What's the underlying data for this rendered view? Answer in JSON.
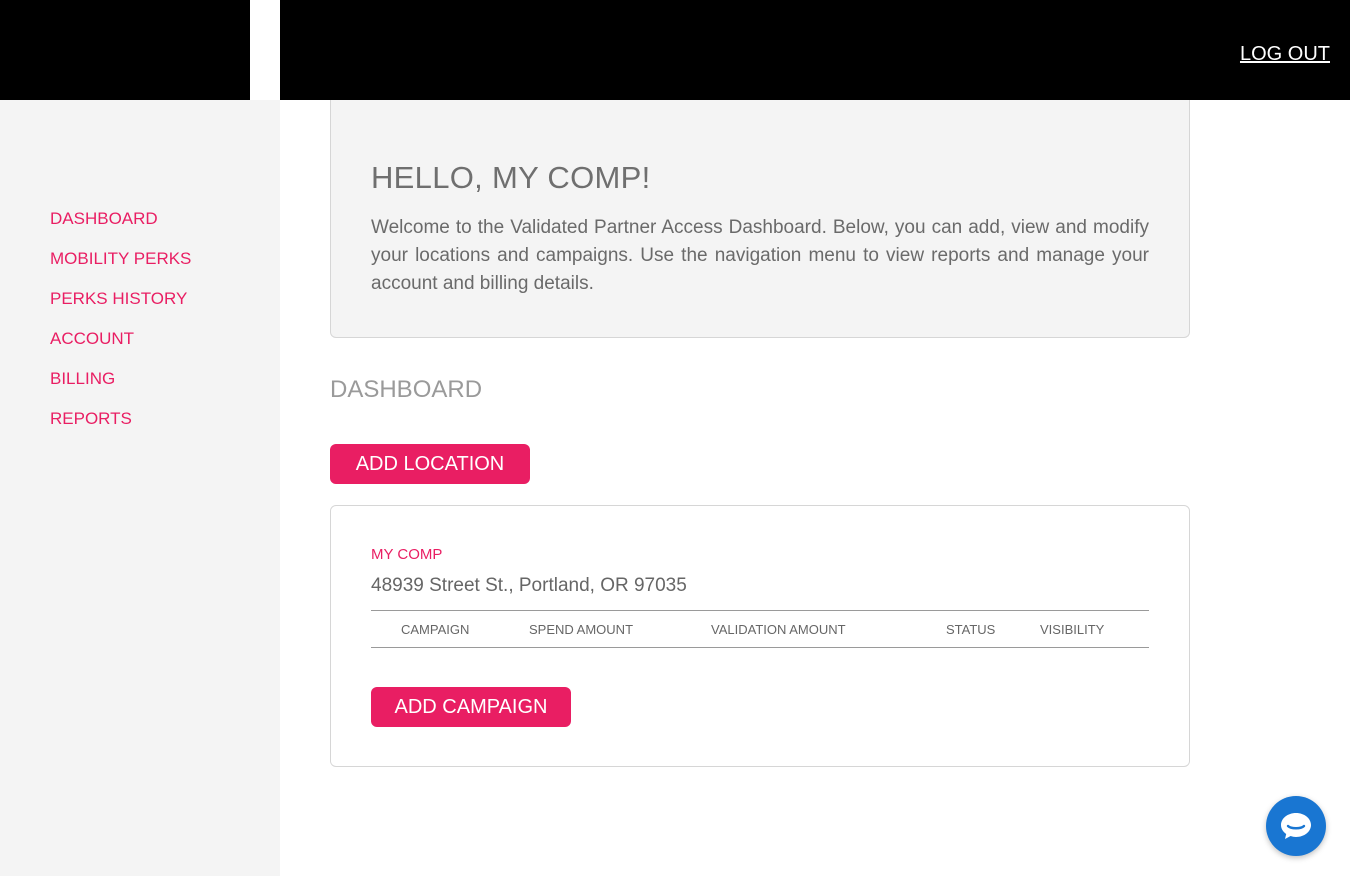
{
  "header": {
    "logout_label": "LOG OUT"
  },
  "sidebar": {
    "items": [
      {
        "label": "DASHBOARD"
      },
      {
        "label": "MOBILITY PERKS"
      },
      {
        "label": "PERKS HISTORY"
      },
      {
        "label": "ACCOUNT"
      },
      {
        "label": "BILLING"
      },
      {
        "label": "REPORTS"
      }
    ]
  },
  "welcome": {
    "title": "HELLO, MY COMP!",
    "body": "Welcome to the Validated Partner Access Dashboard. Below, you can add, view and modify your locations and campaigns. Use the navigation menu to view reports and manage your account and billing details."
  },
  "dashboard": {
    "title": "DASHBOARD",
    "add_location_label": "ADD LOCATION",
    "location": {
      "name": "MY COMP",
      "address": "48939 Street St., Portland, OR 97035",
      "columns": [
        "CAMPAIGN",
        "SPEND AMOUNT",
        "VALIDATION AMOUNT",
        "STATUS",
        "VISIBILITY"
      ],
      "add_campaign_label": "ADD CAMPAIGN"
    }
  },
  "colors": {
    "accent": "#e91e63",
    "topbar": "#000000",
    "sidebar_bg": "#f4f4f4",
    "chat": "#1976d2"
  },
  "chat": {
    "icon": "chat-bubble-icon"
  }
}
